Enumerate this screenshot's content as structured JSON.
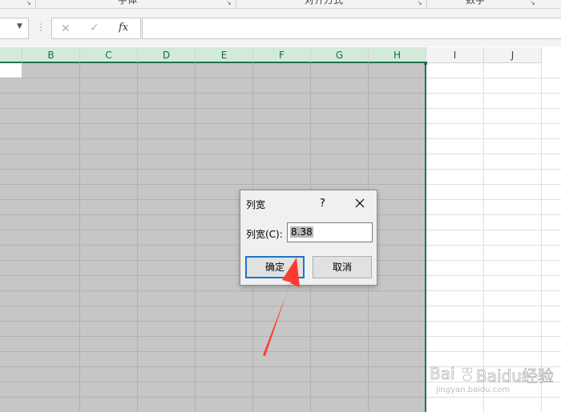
{
  "ribbon": {
    "groups": [
      {
        "label": "字体"
      },
      {
        "label": "对齐方式"
      },
      {
        "label": "数字"
      }
    ]
  },
  "formula_bar": {
    "name_box_value": "",
    "cancel_icon": "✕",
    "enter_icon": "✓",
    "fx_label": "fx",
    "formula_value": ""
  },
  "grid": {
    "columns": [
      "B",
      "C",
      "D",
      "E",
      "F",
      "G",
      "H",
      "I",
      "J"
    ],
    "selected_columns": [
      "B",
      "C",
      "D",
      "E",
      "F",
      "G",
      "H"
    ],
    "selection_color": "#c6c6c6",
    "accent_color": "#217346"
  },
  "dialog": {
    "title": "列宽",
    "help": "?",
    "field_label": "列宽(C):",
    "field_value": "8.38",
    "ok_label": "确定",
    "cancel_label": "取消"
  },
  "annotation": {
    "arrow_color": "#ff3b2f"
  },
  "watermark": {
    "text": "Baidu经验",
    "subtext": "jingyan.baidu.com"
  }
}
